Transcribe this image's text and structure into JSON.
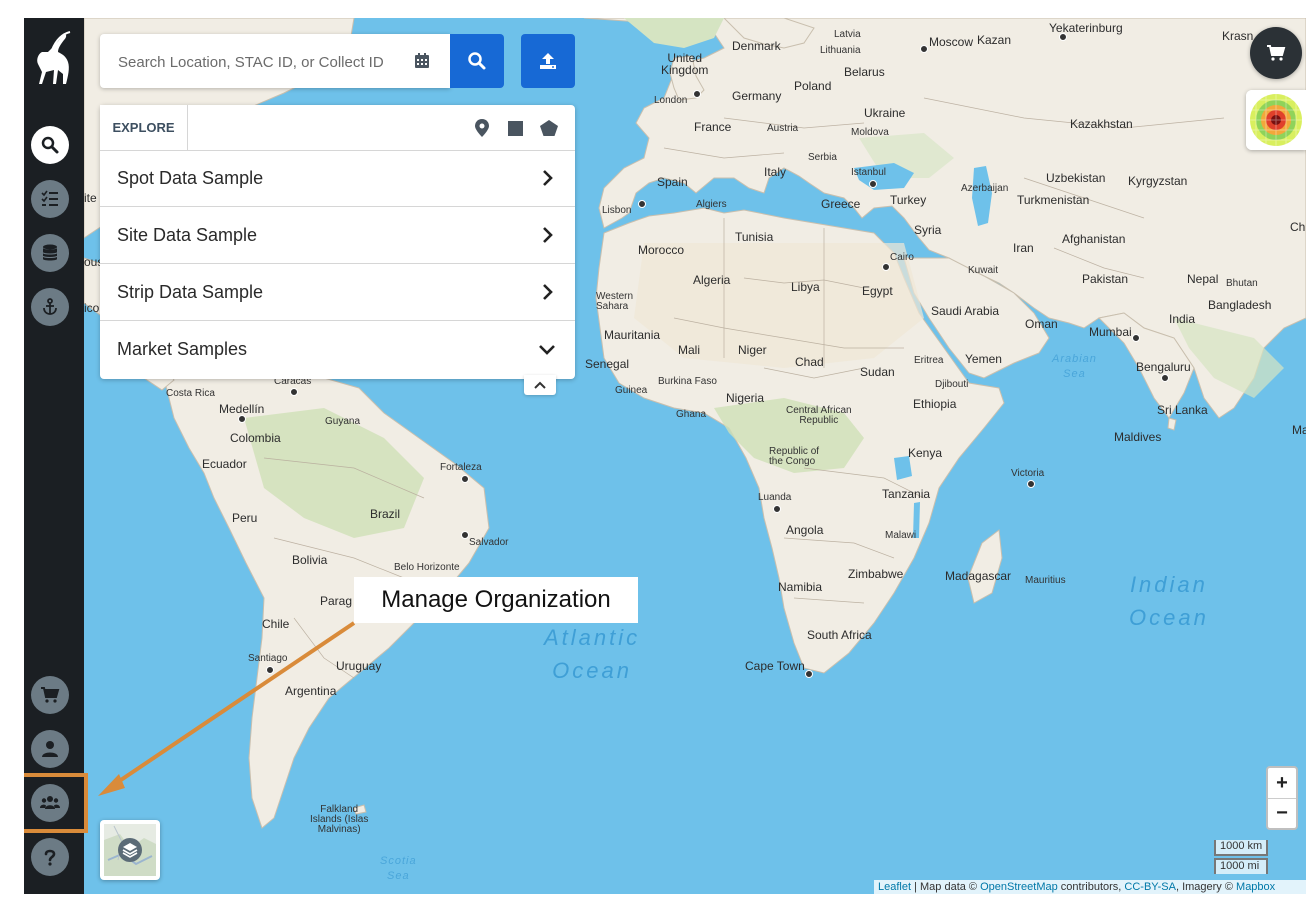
{
  "search": {
    "placeholder": "Search Location, STAC ID, or Collect ID",
    "calendar_icon": "calendar-icon",
    "search_icon": "search-icon",
    "upload_icon": "upload-icon"
  },
  "explore": {
    "tab_label": "EXPLORE",
    "tools": [
      "map-pin-icon",
      "square-icon",
      "polygon-icon"
    ],
    "items": [
      {
        "label": "Spot Data Sample",
        "icon": "chevron-right-icon"
      },
      {
        "label": "Site Data Sample",
        "icon": "chevron-right-icon"
      },
      {
        "label": "Strip Data Sample",
        "icon": "chevron-right-icon"
      },
      {
        "label": "Market Samples",
        "icon": "chevron-down-icon"
      }
    ]
  },
  "sidebar": {
    "logo": "ibex-logo",
    "items": [
      "search-icon",
      "task-list-icon",
      "database-icon",
      "anchor-icon",
      "cart-icon",
      "user-icon",
      "organization-icon",
      "help-icon"
    ]
  },
  "annotation": {
    "callout_text": "Manage Organization",
    "highlight_color": "#d98b3a"
  },
  "controls": {
    "zoom_in": "+",
    "zoom_out": "−",
    "scale_km": "1000 km",
    "scale_mi": "1000 mi"
  },
  "attribution": {
    "leaflet": "Leaflet",
    "sep": " | Map data © ",
    "osm": "OpenStreetMap",
    "contrib": " contributors, ",
    "license": "CC-BY-SA",
    "imagery": ", Imagery © ",
    "mapbox": "Mapbox"
  },
  "map": {
    "oceans": {
      "south_atlantic": "h\nAtlantic\nOcean",
      "indian": "Indian\nOcean"
    },
    "seas": {
      "arabian": "Arabian\nSea",
      "scotia": "Scotia\nSea"
    },
    "labels": {
      "latvia": "Latvia",
      "lithuania": "Lithuania",
      "moscow": "Moscow",
      "kazan": "Kazan",
      "yekaterinburg": "Yekaterinburg",
      "krasn": "Krasn",
      "denmark": "Denmark",
      "united_kingdom": "United\nKingdom",
      "belarus": "Belarus",
      "london": "London",
      "germany": "Germany",
      "poland": "Poland",
      "ukraine": "Ukraine",
      "kazakhstan": "Kazakhstan",
      "france": "France",
      "austria": "Austria",
      "moldova": "Moldova",
      "serbia": "Serbia",
      "spain": "Spain",
      "italy": "Italy",
      "istanbul": "Istanbul",
      "azerbaijan": "Azerbaijan",
      "uzbekistan": "Uzbekistan",
      "kyrgyzstan": "Kyrgyzstan",
      "lisbon": "Lisbon",
      "algiers": "Algiers",
      "greece": "Greece",
      "turkey": "Turkey",
      "turkmenistan": "Turkmenistan",
      "tunisia": "Tunisia",
      "syria": "Syria",
      "morocco": "Morocco",
      "iran": "Iran",
      "afghanistan": "Afghanistan",
      "cairo": "Cairo",
      "kuwait": "Kuwait",
      "algeria": "Algeria",
      "libya": "Libya",
      "egypt": "Egypt",
      "pakistan": "Pakistan",
      "nepal": "Nepal",
      "bhutan": "Bhutan",
      "western_sahara": "Western\nSahara",
      "saudi_arabia": "Saudi Arabia",
      "bangladesh": "Bangladesh",
      "oman": "Oman",
      "mumbai": "Mumbai",
      "india": "India",
      "mauritania": "Mauritania",
      "mali": "Mali",
      "niger": "Niger",
      "eritrea": "Eritrea",
      "yemen": "Yemen",
      "senegal": "Senegal",
      "chad": "Chad",
      "sudan": "Sudan",
      "bengaluru": "Bengaluru",
      "burkina_faso": "Burkina Faso",
      "djibouti": "Djibouti",
      "guinea": "Guinea",
      "nigeria": "Nigeria",
      "ethiopia": "Ethiopia",
      "ghana": "Ghana",
      "central_african_republic": "Central African\nRepublic",
      "sri_lanka": "Sri Lanka",
      "maldives": "Maldives",
      "ma": "Ma",
      "caracas": "Caracas",
      "costa_rica": "Costa Rica",
      "medellin": "Medellín",
      "guyana": "Guyana",
      "colombia": "Colombia",
      "republic_of_the_congo": "Republic of\nthe Congo",
      "kenya": "Kenya",
      "ecuador": "Ecuador",
      "fortaleza": "Fortaleza",
      "victoria": "Victoria",
      "luanda": "Luanda",
      "tanzania": "Tanzania",
      "peru": "Peru",
      "brazil": "Brazil",
      "angola": "Angola",
      "malawi": "Malawi",
      "salvador": "Salvador",
      "bolivia": "Bolivia",
      "belo_horizonte": "Belo Horizonte",
      "zimbabwe": "Zimbabwe",
      "madagascar": "Madagascar",
      "mauritius": "Mauritius",
      "namibia": "Namibia",
      "paraguay_partial": "Parag",
      "chile": "Chile",
      "south_africa": "South Africa",
      "santiago": "Santiago",
      "uruguay": "Uruguay",
      "cape_town": "Cape Town",
      "argentina": "Argentina",
      "falkland": "Falkland\nIslands (Islas\nMalvinas)",
      "ite": "ite",
      "ous": "ous",
      "ico": "ico",
      "ch": "Ch"
    }
  }
}
